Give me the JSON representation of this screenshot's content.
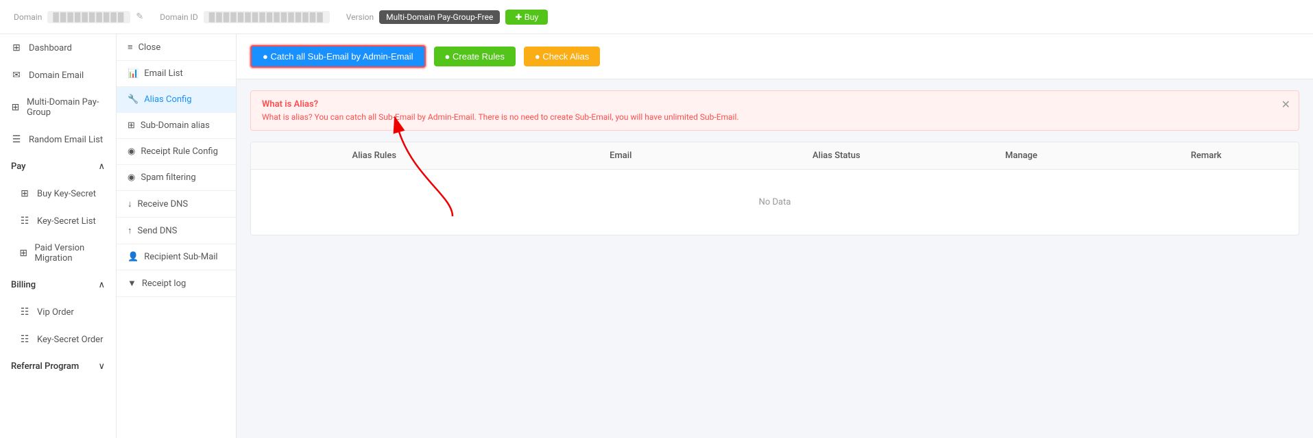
{
  "header": {
    "domain_label": "Domain",
    "domain_value": "██████████",
    "domain_id_label": "Domain ID",
    "domain_id_value": "████████████████",
    "version_label": "Version",
    "version_badge": "Multi-Domain Pay-Group-Free",
    "buy_label": "✚ Buy"
  },
  "sidebar": {
    "items": [
      {
        "id": "dashboard",
        "icon": "⊞",
        "label": "Dashboard"
      },
      {
        "id": "domain-email",
        "icon": "✉",
        "label": "Domain Email"
      },
      {
        "id": "multi-domain",
        "icon": "☰",
        "label": "Multi-Domain Pay-Group"
      },
      {
        "id": "random-email",
        "icon": "☰",
        "label": "Random Email List"
      },
      {
        "id": "pay",
        "icon": "",
        "label": "Pay",
        "expandable": true,
        "expanded": true
      },
      {
        "id": "buy-key-secret",
        "icon": "⊞",
        "label": "Buy Key-Secret",
        "sub": true
      },
      {
        "id": "key-secret-list",
        "icon": "☷",
        "label": "Key-Secret List",
        "sub": true
      },
      {
        "id": "paid-version-migration",
        "icon": "⊞",
        "label": "Paid Version Migration",
        "sub": true
      },
      {
        "id": "billing",
        "icon": "",
        "label": "Billing",
        "expandable": true,
        "expanded": true
      },
      {
        "id": "vip-order",
        "icon": "☷",
        "label": "Vip Order",
        "sub": true
      },
      {
        "id": "key-secret-order",
        "icon": "☷",
        "label": "Key-Secret Order",
        "sub": true
      },
      {
        "id": "referral-program",
        "icon": "",
        "label": "Referral Program",
        "expandable": true,
        "expanded": true
      }
    ]
  },
  "secondary_sidebar": {
    "items": [
      {
        "id": "close",
        "icon": "≡",
        "label": "Close"
      },
      {
        "id": "email-list",
        "icon": "📊",
        "label": "Email List"
      },
      {
        "id": "alias-config",
        "icon": "🔧",
        "label": "Alias Config",
        "active": true
      },
      {
        "id": "sub-domain-alias",
        "icon": "⊞",
        "label": "Sub-Domain alias"
      },
      {
        "id": "receipt-rule-config",
        "icon": "◉",
        "label": "Receipt Rule Config"
      },
      {
        "id": "spam-filtering",
        "icon": "◉",
        "label": "Spam filtering"
      },
      {
        "id": "receive-dns",
        "icon": "↓",
        "label": "Receive DNS"
      },
      {
        "id": "send-dns",
        "icon": "↑",
        "label": "Send DNS"
      },
      {
        "id": "recipient-sub-mail",
        "icon": "👤",
        "label": "Recipient Sub-Mail"
      },
      {
        "id": "receipt-log",
        "icon": "▼",
        "label": "Receipt log"
      }
    ]
  },
  "toolbar": {
    "catch_all_label": "● Catch all Sub-Email by Admin-Email",
    "create_rules_label": "● Create Rules",
    "check_alias_label": "● Check Alias"
  },
  "info_box": {
    "title": "What is Alias?",
    "description": "What is alias? You can catch all Sub-Email by Admin-Email. There is no need to create Sub-Email, you will have unlimited Sub-Email."
  },
  "table": {
    "columns": [
      "Alias Rules",
      "Email",
      "Alias Status",
      "Manage",
      "Remark"
    ],
    "empty_text": "No Data"
  },
  "colors": {
    "blue": "#1890ff",
    "green": "#52c41a",
    "yellow": "#faad14",
    "red": "#ff4d4f",
    "gray_badge": "#666"
  }
}
